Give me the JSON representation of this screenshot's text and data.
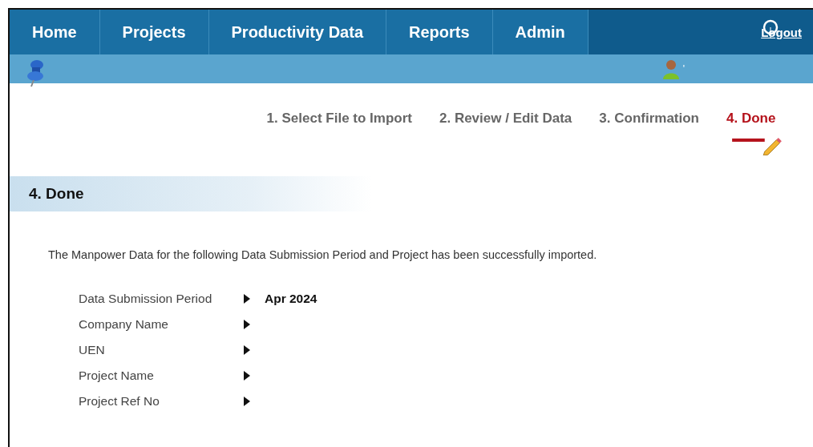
{
  "nav": {
    "items": [
      {
        "label": "Home"
      },
      {
        "label": "Projects"
      },
      {
        "label": "Productivity Data"
      },
      {
        "label": "Reports"
      },
      {
        "label": "Admin"
      }
    ],
    "logout": "Logout",
    "user_mark": "'"
  },
  "steps": [
    {
      "label": "1. Select File to Import",
      "selected": false
    },
    {
      "label": "2. Review / Edit Data",
      "selected": false
    },
    {
      "label": "3. Confirmation",
      "selected": false
    },
    {
      "label": "4. Done",
      "selected": true
    }
  ],
  "section": {
    "title": "4. Done"
  },
  "message": "The Manpower Data for the following Data Submission Period and Project has been successfully imported.",
  "fields": [
    {
      "label": "Data Submission Period",
      "value": "Apr 2024"
    },
    {
      "label": "Company Name"
    },
    {
      "label": "UEN"
    },
    {
      "label": "Project Name"
    },
    {
      "label": "Project Ref No"
    }
  ]
}
